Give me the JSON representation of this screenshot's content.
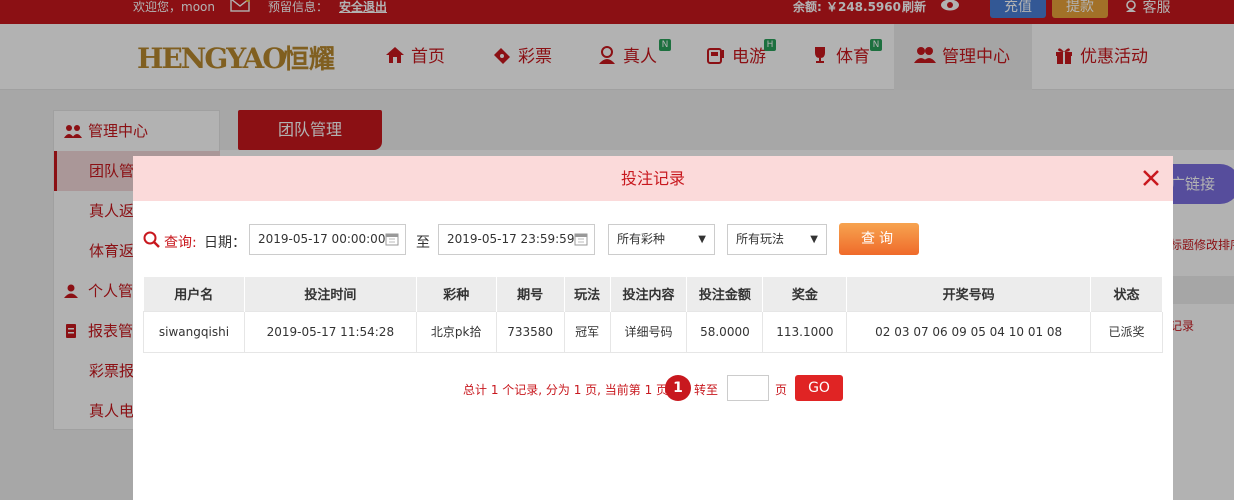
{
  "topbar": {
    "welcome": "欢迎您，moon",
    "notice_label": "预留信息：",
    "logout": "安全退出",
    "balance": "余额: ￥248.5960",
    "refresh": "刷新",
    "recharge": "充值",
    "withdraw": "提款",
    "service": "客服"
  },
  "nav": {
    "logo": "HENGYAO恒耀",
    "items": [
      {
        "label": "首页",
        "icon": "home-icon"
      },
      {
        "label": "彩票",
        "icon": "ticket-icon"
      },
      {
        "label": "真人",
        "icon": "live-dealer-icon",
        "badge": "N"
      },
      {
        "label": "电游",
        "icon": "slot-machine-icon",
        "badge": "H"
      },
      {
        "label": "体育",
        "icon": "trophy-icon",
        "badge": "N"
      },
      {
        "label": "管理中心",
        "icon": "users-icon"
      },
      {
        "label": "优惠活动",
        "icon": "gift-icon"
      }
    ]
  },
  "sidebar": {
    "management": "管理中心",
    "team": "团队管",
    "live_rebate": "真人返",
    "sports_rebate": "体育返",
    "personal": "个人管",
    "reports": "报表管",
    "lottery_report": "彩票报",
    "live_report": "真人电"
  },
  "main": {
    "team_tab": "团队管理",
    "promo_link": "广链接",
    "right_text1": "标题修改排序",
    "right_text2": "记录"
  },
  "modal": {
    "title": "投注记录",
    "query_label": "查询:",
    "date_label": "日期：",
    "date_from": "2019-05-17 00:00:00",
    "to_label": "至",
    "date_to": "2019-05-17 23:59:59",
    "lottery_select": "所有彩种",
    "play_select": "所有玩法",
    "search_button": "查询",
    "table": {
      "headers": [
        "用户名",
        "投注时间",
        "彩种",
        "期号",
        "玩法",
        "投注内容",
        "投注金额",
        "奖金",
        "开奖号码",
        "状态"
      ],
      "rows": [
        [
          "siwangqishi",
          "2019-05-17 11:54:28",
          "北京pk拾",
          "733580",
          "冠军",
          "详细号码",
          "58.0000",
          "113.1000",
          "02 03 07 06 09 05 04 10 01 08",
          "已派奖"
        ]
      ]
    },
    "pager": {
      "summary": "总计 1 个记录, 分为 1 页, 当前第 1 页",
      "current": "1",
      "goto": "转至",
      "unit": "页",
      "go": "GO"
    }
  },
  "colors": {
    "brand_red": "#c8181e",
    "modal_header": "#fbdada",
    "search_orange": "#ef6a2a",
    "green_text": "#2a8f2a"
  }
}
